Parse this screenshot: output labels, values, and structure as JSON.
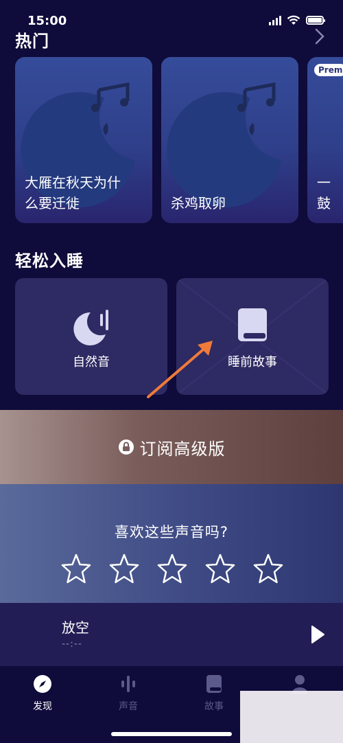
{
  "status_bar": {
    "time": "15:00"
  },
  "hot_section": {
    "title": "热门",
    "cards": [
      {
        "caption": "大雁在秋天为什么要迁徙",
        "caption_line1": "大雁在秋天为什",
        "caption_line2": "么要迁徙"
      },
      {
        "caption": "杀鸡取卵"
      },
      {
        "caption": "一鼓",
        "badge": "Prem"
      }
    ]
  },
  "sleep_section": {
    "title": "轻松入睡",
    "cards": [
      {
        "label": "自然音",
        "icon": "moon-sound-icon"
      },
      {
        "label": "睡前故事",
        "icon": "book-icon"
      }
    ]
  },
  "subscribe": {
    "label": "订阅高级版",
    "icon": "lock-icon"
  },
  "rating": {
    "question": "喜欢这些声音吗?",
    "stars": 5
  },
  "player": {
    "title": "放空",
    "time": "--:--"
  },
  "tabs": [
    {
      "label": "发现",
      "icon": "compass-icon",
      "active": true
    },
    {
      "label": "声音",
      "icon": "sound-bars-icon",
      "active": false
    },
    {
      "label": "故事",
      "icon": "book-icon",
      "active": false
    },
    {
      "label": "",
      "icon": "profile-icon",
      "active": false
    }
  ],
  "colors": {
    "background": "#0f0b3a",
    "card": "#2e2a63",
    "accent_arrow": "#f07a3a",
    "subscribe_bar": "#7a5d5b"
  }
}
